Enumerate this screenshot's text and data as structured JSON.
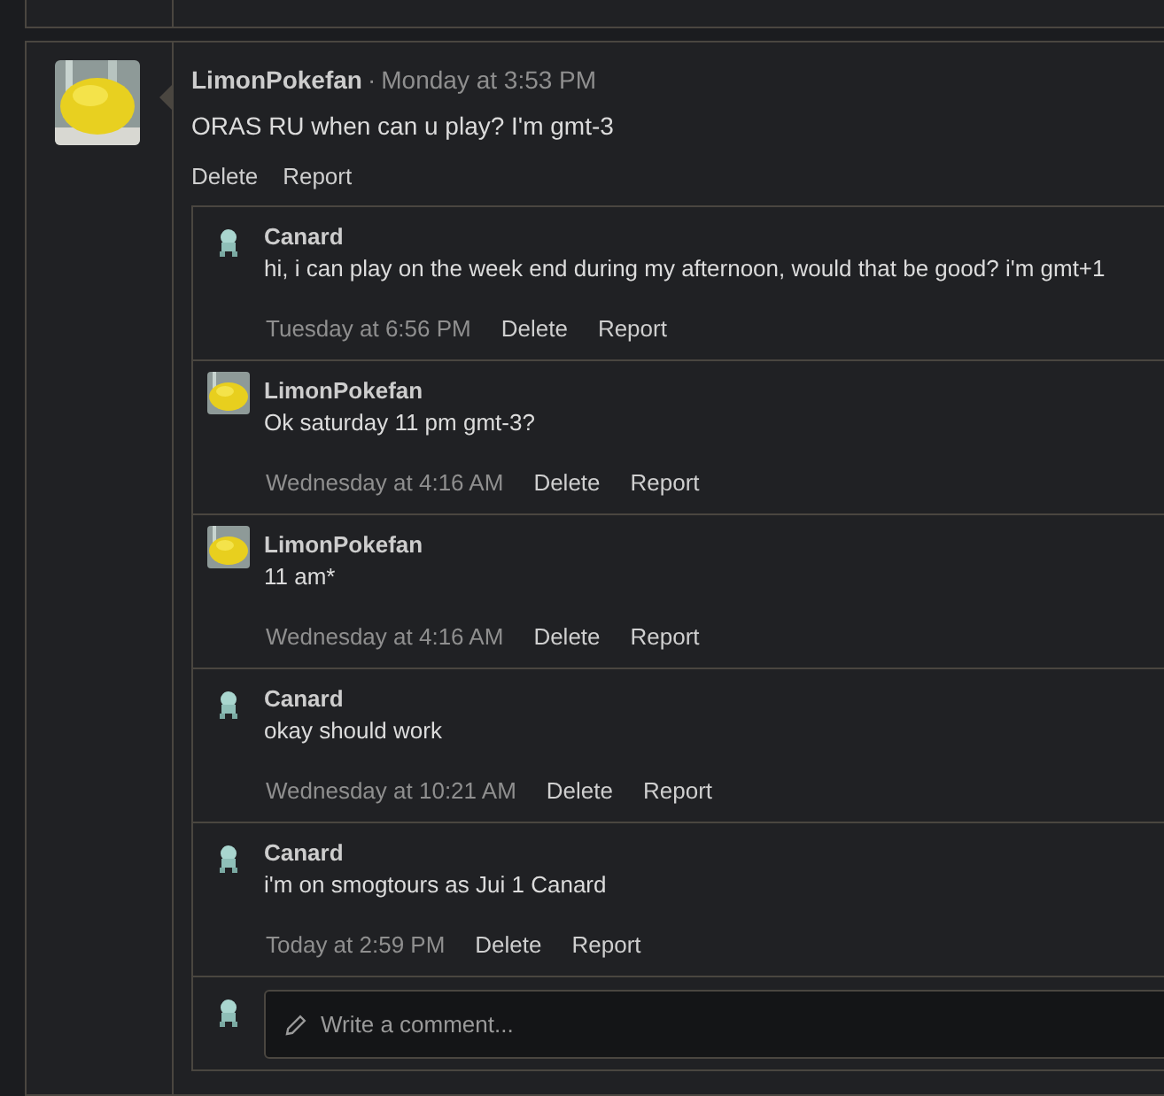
{
  "post": {
    "author": "LimonPokefan",
    "time": "Monday at 3:53 PM",
    "separator": "·",
    "message": "ORAS RU when can u play? I'm gmt-3",
    "actions": [
      "Delete",
      "Report"
    ]
  },
  "comments": [
    {
      "author": "Canard",
      "kind": "sprite",
      "message": "hi, i can play on the week end during my afternoon, would that be good? i'm gmt+1",
      "time": "Tuesday at 6:56 PM",
      "actions": [
        "Delete",
        "Report"
      ]
    },
    {
      "author": "LimonPokefan",
      "kind": "lemon",
      "message": "Ok saturday 11 pm gmt-3?",
      "time": "Wednesday at 4:16 AM",
      "actions": [
        "Delete",
        "Report"
      ]
    },
    {
      "author": "LimonPokefan",
      "kind": "lemon",
      "message": "11 am*",
      "time": "Wednesday at 4:16 AM",
      "actions": [
        "Delete",
        "Report"
      ]
    },
    {
      "author": "Canard",
      "kind": "sprite",
      "message": "okay should work",
      "time": "Wednesday at 10:21 AM",
      "actions": [
        "Delete",
        "Report"
      ]
    },
    {
      "author": "Canard",
      "kind": "sprite",
      "message": "i'm on smogtours as Jui 1 Canard",
      "time": "Today at 2:59 PM",
      "actions": [
        "Delete",
        "Report"
      ]
    }
  ],
  "reply_box": {
    "placeholder": "Write a comment..."
  }
}
